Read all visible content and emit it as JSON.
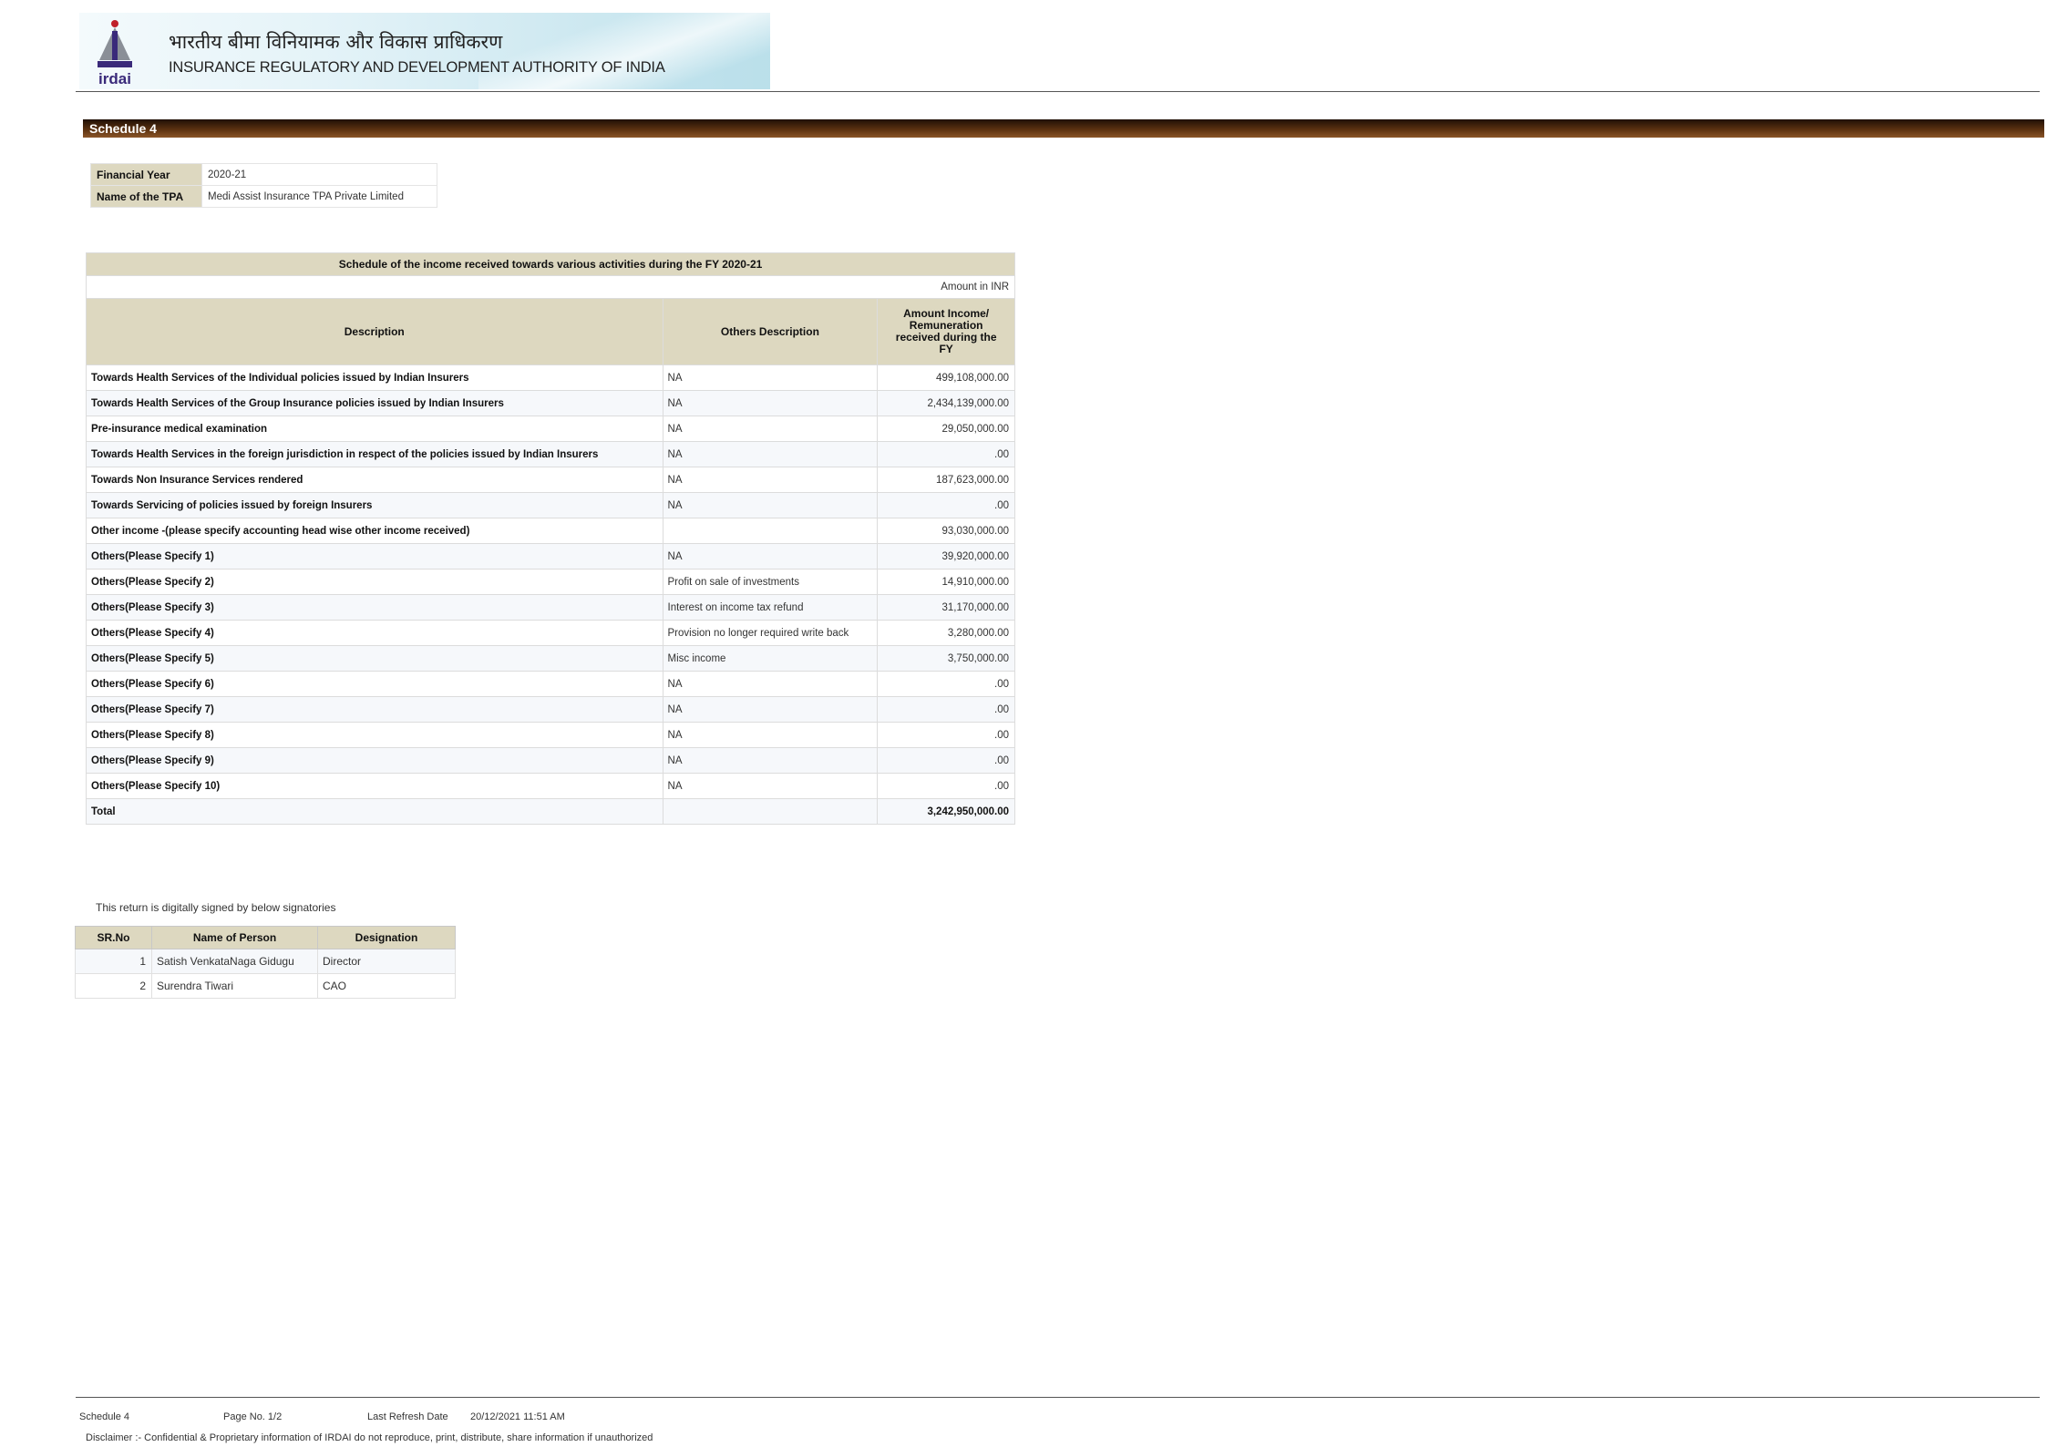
{
  "header": {
    "title_hindi": "भारतीय बीमा विनियामक और विकास प्राधिकरण",
    "title_english": "INSURANCE REGULATORY AND DEVELOPMENT AUTHORITY OF INDIA",
    "logo_icon": "irdai-logo-icon",
    "logo_text": "irdai"
  },
  "schedule_bar": {
    "label": "Schedule 4"
  },
  "meta": [
    {
      "label": "Financial Year",
      "value": "2020-21"
    },
    {
      "label": "Name of the TPA",
      "value": "Medi Assist Insurance TPA Private Limited"
    }
  ],
  "income": {
    "caption": "Schedule of the income received towards various activities during the FY 2020-21",
    "unit": "Amount in INR",
    "columns": {
      "description": "Description",
      "others": "Others Description",
      "amount": "Amount Income/ Remuneration received during the FY"
    },
    "rows": [
      {
        "description": "Towards Health Services of the Individual policies issued by Indian Insurers",
        "others": "NA",
        "amount": "499,108,000.00"
      },
      {
        "description": "Towards Health Services of the Group Insurance policies issued by Indian Insurers",
        "others": "NA",
        "amount": "2,434,139,000.00"
      },
      {
        "description": "Pre-insurance medical examination",
        "others": "NA",
        "amount": "29,050,000.00"
      },
      {
        "description": "Towards Health Services in the foreign jurisdiction in respect of the policies issued by Indian Insurers",
        "others": "NA",
        "amount": ".00"
      },
      {
        "description": "Towards Non Insurance Services rendered",
        "others": "NA",
        "amount": "187,623,000.00"
      },
      {
        "description": "Towards Servicing of policies issued by foreign Insurers",
        "others": "NA",
        "amount": ".00"
      },
      {
        "description": "Other income -(please specify accounting head wise  other income received)",
        "others": "",
        "amount": "93,030,000.00"
      },
      {
        "description": "Others(Please Specify 1)",
        "others": "NA",
        "amount": "39,920,000.00"
      },
      {
        "description": "Others(Please Specify 2)",
        "others": "Profit on sale of investments",
        "amount": "14,910,000.00"
      },
      {
        "description": "Others(Please Specify 3)",
        "others": "Interest on income tax refund",
        "amount": "31,170,000.00"
      },
      {
        "description": "Others(Please Specify 4)",
        "others": "Provision no longer required write back",
        "amount": "3,280,000.00"
      },
      {
        "description": "Others(Please Specify 5)",
        "others": "Misc income",
        "amount": "3,750,000.00"
      },
      {
        "description": "Others(Please Specify 6)",
        "others": "NA",
        "amount": ".00"
      },
      {
        "description": "Others(Please Specify 7)",
        "others": "NA",
        "amount": ".00"
      },
      {
        "description": "Others(Please Specify 8)",
        "others": "NA",
        "amount": ".00"
      },
      {
        "description": "Others(Please Specify 9)",
        "others": "NA",
        "amount": ".00"
      },
      {
        "description": "Others(Please Specify 10)",
        "others": "NA",
        "amount": ".00"
      }
    ],
    "total": {
      "label": "Total",
      "others": "",
      "amount": "3,242,950,000.00"
    }
  },
  "signatories": {
    "note": "This return is digitally signed by below signatories",
    "columns": {
      "sr": "SR.No",
      "name": "Name of Person",
      "designation": "Designation"
    },
    "rows": [
      {
        "sr": "1",
        "name": "Satish VenkataNaga Gidugu",
        "designation": "Director"
      },
      {
        "sr": "2",
        "name": "Surendra Tiwari",
        "designation": "CAO"
      }
    ]
  },
  "footer": {
    "schedule": "Schedule 4",
    "page": "Page No. 1/2",
    "refresh_label": "Last Refresh Date",
    "refresh_value": "20/12/2021 11:51 AM",
    "disclaimer": "Disclaimer :- Confidential & Proprietary information of IRDAI do not reproduce, print, distribute, share information if unauthorized"
  },
  "colors": {
    "header_fill": "#ddd8c0",
    "bar_dark": "#1f1005",
    "bar_light": "#8a5528",
    "logo_purple": "#3a2a7a",
    "logo_red": "#c0202a"
  }
}
